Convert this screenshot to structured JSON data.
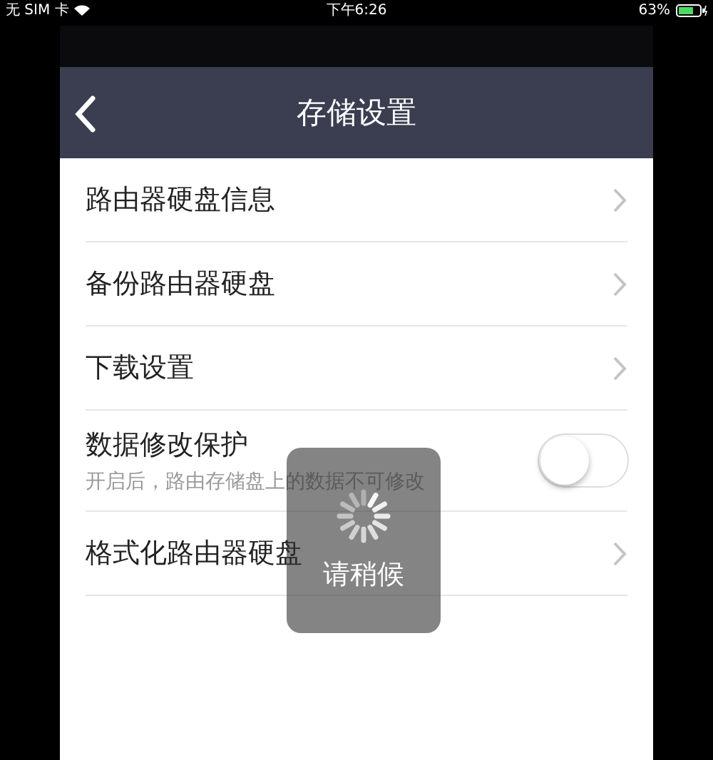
{
  "status_bar": {
    "carrier": "无 SIM 卡",
    "time": "下午6:26",
    "battery": "63%"
  },
  "nav": {
    "title": "存储设置"
  },
  "items": [
    {
      "kind": "link",
      "label": "路由器硬盘信息"
    },
    {
      "kind": "link",
      "label": "备份路由器硬盘"
    },
    {
      "kind": "link",
      "label": "下载设置"
    },
    {
      "kind": "toggle",
      "label": "数据修改保护",
      "description": "开启后，路由存储盘上的数据不可修改",
      "on": false
    },
    {
      "kind": "link",
      "label": "格式化路由器硬盘"
    }
  ],
  "toast": {
    "message": "请稍候"
  }
}
